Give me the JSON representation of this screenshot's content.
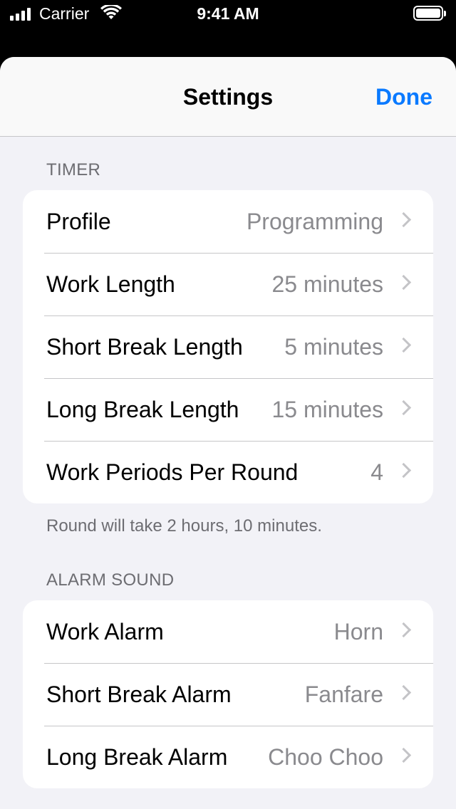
{
  "status_bar": {
    "carrier": "Carrier",
    "time": "9:41 AM",
    "icons": [
      "signal-icon",
      "wifi-icon",
      "battery-icon"
    ]
  },
  "nav": {
    "title": "Settings",
    "done_label": "Done",
    "accent_color": "#0a7aff"
  },
  "timer_section": {
    "header": "TIMER",
    "rows": [
      {
        "label": "Profile",
        "value": "Programming"
      },
      {
        "label": "Work Length",
        "value": "25 minutes"
      },
      {
        "label": "Short Break Length",
        "value": "5 minutes"
      },
      {
        "label": "Long Break Length",
        "value": "15 minutes"
      },
      {
        "label": "Work Periods Per Round",
        "value": "4"
      }
    ],
    "footer": "Round will take 2 hours, 10 minutes."
  },
  "alarm_section": {
    "header": "ALARM SOUND",
    "rows": [
      {
        "label": "Work Alarm",
        "value": "Horn"
      },
      {
        "label": "Short Break Alarm",
        "value": "Fanfare"
      },
      {
        "label": "Long Break Alarm",
        "value": "Choo Choo"
      }
    ]
  }
}
